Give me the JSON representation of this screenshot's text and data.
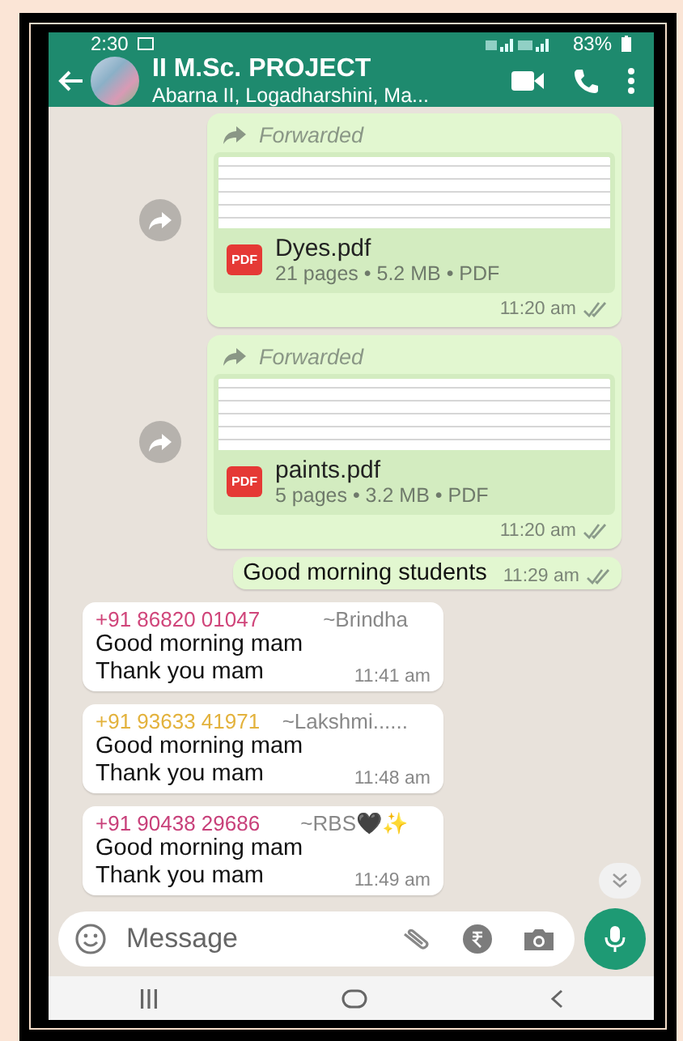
{
  "status_bar": {
    "time": "2:30",
    "battery": "83%"
  },
  "header": {
    "title": "II M.Sc. PROJECT",
    "subtitle": "Abarna II, Logadharshini, Ma..."
  },
  "messages": [
    {
      "kind": "document",
      "forwarded": "Forwarded",
      "file_type": "PDF",
      "file_name": "Dyes.pdf",
      "details": "21 pages • 5.2 MB • PDF",
      "time": "11:20 am",
      "read": false
    },
    {
      "kind": "document",
      "forwarded": "Forwarded",
      "file_type": "PDF",
      "file_name": "paints.pdf",
      "details": "5 pages • 3.2 MB • PDF",
      "time": "11:20 am",
      "read": false
    },
    {
      "kind": "text",
      "text": "Good morning students",
      "time": "11:29 am",
      "read": false
    },
    {
      "kind": "incoming",
      "sender": "+91 86820 01047",
      "color": "#d0457a",
      "name": "~Brindha",
      "lines": [
        "Good morning mam",
        "Thank you mam"
      ],
      "time": "11:41 am"
    },
    {
      "kind": "incoming",
      "sender": "+91 93633 41971",
      "color": "#e3b23c",
      "name": "~Lakshmi......",
      "lines": [
        "Good morning mam",
        "Thank you mam"
      ],
      "time": "11:48 am"
    },
    {
      "kind": "incoming",
      "sender": "+91 90438 29686",
      "color": "#c8407a",
      "name": "~RBS🖤✨",
      "lines": [
        "Good morning mam",
        "Thank you mam"
      ],
      "time": "11:49 am"
    }
  ],
  "composer": {
    "placeholder": "Message"
  }
}
